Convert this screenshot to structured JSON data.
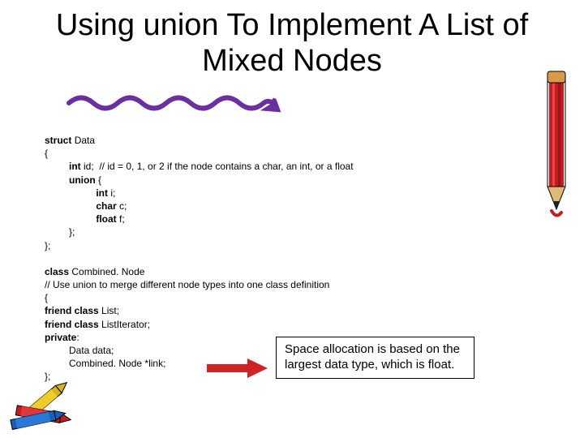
{
  "title": "Using union To Implement A List of Mixed Nodes",
  "code": {
    "l1a": "struct ",
    "l1b": "Data",
    "l2": "{",
    "l3a": "         int ",
    "l3b": "id;  // id = 0, 1, or 2 if the node contains a char, an int, or a float",
    "l4a": "         union ",
    "l4b": "{",
    "l5a": "                   int ",
    "l5b": "i;",
    "l6a": "                   char ",
    "l6b": "c;",
    "l7a": "                   float ",
    "l7b": "f;",
    "l8": "         };",
    "l9": "};",
    "blank": "",
    "l10a": "class ",
    "l10b": "Combined. Node",
    "l11": "// Use union to merge different node types into one class definition",
    "l12": "{",
    "l13a": "friend class ",
    "l13b": "List;",
    "l14a": "friend class ",
    "l14b": "ListIterator;",
    "l15a": "private",
    "l15b": ":",
    "l16": "         Data data;",
    "l17": "         Combined. Node *link;",
    "l18": "};"
  },
  "note": "Space allocation is based on the largest data type, which is float."
}
